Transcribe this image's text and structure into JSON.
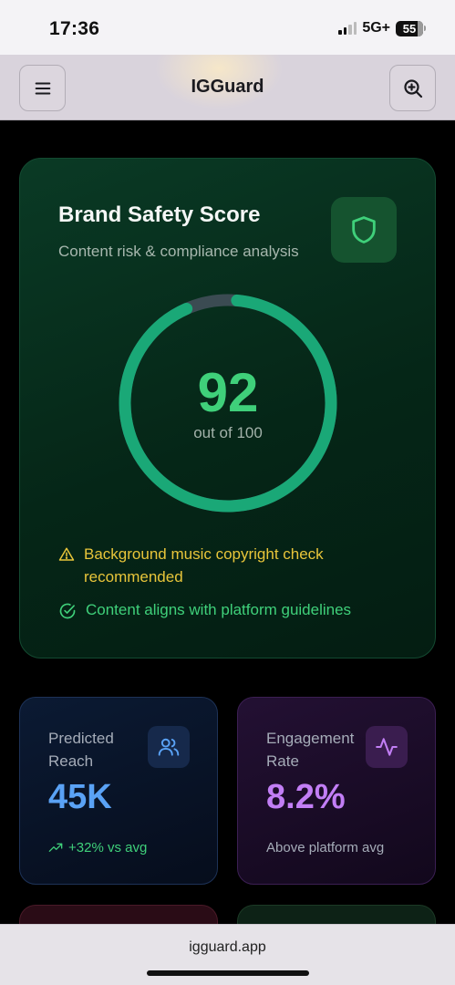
{
  "status_bar": {
    "time": "17:36",
    "network": "5G+",
    "battery": "55"
  },
  "header": {
    "title": "IGGuard",
    "menu_icon": "hamburger-menu-icon",
    "zoom_icon": "zoom-in-icon"
  },
  "score_card": {
    "title": "Brand Safety Score",
    "subtitle": "Content risk & compliance analysis",
    "score": "92",
    "score_max_label": "out of 100",
    "score_fraction": 0.92,
    "accent_color": "#1aa877",
    "notes": [
      {
        "type": "warning",
        "icon": "warning-triangle-icon",
        "text": "Background music copyright check recommended",
        "color": "#e8c53a"
      },
      {
        "type": "ok",
        "icon": "check-circle-icon",
        "text": "Content aligns with platform guidelines",
        "color": "#3fd07a"
      }
    ]
  },
  "stats": {
    "reach": {
      "label": "Predicted Reach",
      "value": "45K",
      "footnote": "+32% vs avg",
      "icon": "users-icon",
      "color": "#5aa2f5"
    },
    "engagement": {
      "label": "Engagement Rate",
      "value": "8.2%",
      "footnote": "Above platform avg",
      "icon": "activity-icon",
      "color": "#c27ef5"
    }
  },
  "browser": {
    "url": "igguard.app"
  }
}
